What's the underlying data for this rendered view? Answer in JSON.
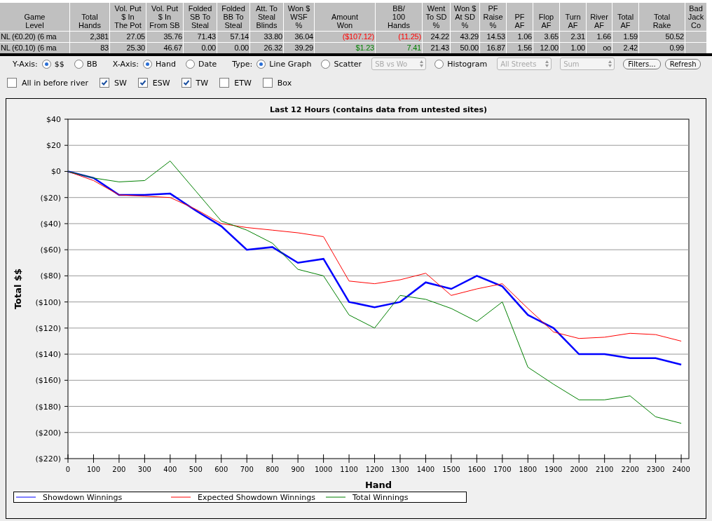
{
  "stats_table": {
    "columns": [
      "Game\nLevel",
      "Total\nHands",
      "Vol. Put\n$ In\nThe Pot",
      "Vol. Put\n$ In\nFrom SB",
      "Folded\nSB To\nSteal",
      "Folded\nBB To\nSteal",
      "Att. To\nSteal\nBlinds",
      "Won $\nWSF\n%",
      "Amount\nWon",
      "BB/\n100\nHands",
      "Went\nTo SD\n%",
      "Won $\nAt SD\n%",
      "PF\nRaise\n%",
      "PF\nAF",
      "Flop\nAF",
      "Turn\nAF",
      "River\nAF",
      "Total\nAF",
      "Total\nRake",
      "Bad\nJack\nCo"
    ],
    "rows": [
      [
        {
          "text": "NL (€0.20) (6 ma"
        },
        {
          "text": "2,381"
        },
        {
          "text": "27.05"
        },
        {
          "text": "35.76"
        },
        {
          "text": "71.43"
        },
        {
          "text": "57.14"
        },
        {
          "text": "33.80"
        },
        {
          "text": "36.04"
        },
        {
          "text": "($107.12)",
          "color": "#ff0000"
        },
        {
          "text": "(11.25)",
          "color": "#ff0000"
        },
        {
          "text": "24.22"
        },
        {
          "text": "43.29"
        },
        {
          "text": "14.53"
        },
        {
          "text": "1.06"
        },
        {
          "text": "3.65"
        },
        {
          "text": "2.31"
        },
        {
          "text": "1.66"
        },
        {
          "text": "1.59"
        },
        {
          "text": "50.52"
        }
      ],
      [
        {
          "text": "NL (€0.10) (6 ma"
        },
        {
          "text": "83"
        },
        {
          "text": "25.30"
        },
        {
          "text": "46.67"
        },
        {
          "text": "0.00"
        },
        {
          "text": "0.00"
        },
        {
          "text": "26.32"
        },
        {
          "text": "39.29"
        },
        {
          "text": "$1.23",
          "color": "#008000"
        },
        {
          "text": "7.41",
          "color": "#008000"
        },
        {
          "text": "21.43"
        },
        {
          "text": "50.00"
        },
        {
          "text": "16.87"
        },
        {
          "text": "1.56"
        },
        {
          "text": "12.00"
        },
        {
          "text": "1.00"
        },
        {
          "text": "oo"
        },
        {
          "text": "2.42"
        },
        {
          "text": "0.99"
        }
      ]
    ]
  },
  "options_rows": [
    [
      {
        "kind": "label",
        "text": "Y-Axis:"
      },
      {
        "kind": "radio",
        "label": "$$",
        "selected": true
      },
      {
        "kind": "radio",
        "label": "BB",
        "selected": false
      },
      {
        "kind": "label",
        "text": "X-Axis:"
      },
      {
        "kind": "radio",
        "label": "Hand",
        "selected": true
      },
      {
        "kind": "radio",
        "label": "Date",
        "selected": false
      },
      {
        "kind": "label",
        "text": "Type:"
      },
      {
        "kind": "radio",
        "label": "Line Graph",
        "selected": true
      },
      {
        "kind": "radio",
        "label": "Scatter",
        "selected": false
      },
      {
        "kind": "dropdown",
        "value": "SB vs Wo",
        "disabled": true
      },
      {
        "kind": "radio",
        "label": "Histogram",
        "selected": false
      },
      {
        "kind": "dropdown",
        "value": "All Streets",
        "disabled": true
      },
      {
        "kind": "dropdown",
        "value": "Sum",
        "disabled": true
      },
      {
        "kind": "button",
        "label": "Filters..."
      },
      {
        "kind": "button",
        "label": "Refresh"
      }
    ],
    [
      {
        "kind": "checkbox",
        "label": "All in before river",
        "checked": false
      },
      {
        "kind": "checkbox",
        "label": "SW",
        "checked": true
      },
      {
        "kind": "checkbox",
        "label": "ESW",
        "checked": true
      },
      {
        "kind": "checkbox",
        "label": "TW",
        "checked": true
      },
      {
        "kind": "checkbox",
        "label": "ETW",
        "checked": false
      },
      {
        "kind": "checkbox",
        "label": "Box",
        "checked": false
      }
    ]
  ],
  "graph": {
    "chart_data": {
      "type": "line",
      "grid": true,
      "title": "Last 12 Hours (contains data from untested sites)",
      "xlabel": "Hand",
      "ylabel": "Total $$",
      "x": [
        0,
        100,
        200,
        300,
        400,
        500,
        600,
        700,
        800,
        900,
        1000,
        1100,
        1200,
        1300,
        1400,
        1500,
        1600,
        1700,
        1800,
        1900,
        2000,
        2100,
        2200,
        2300,
        2400
      ],
      "series": [
        {
          "name": "Showdown Winnings",
          "color": "#0000ff",
          "values": [
            0,
            -5,
            -18,
            -18,
            -17,
            -30,
            -42,
            -60,
            -58,
            -70,
            -67,
            -100,
            -104,
            -100,
            -85,
            -90,
            -80,
            -88,
            -110,
            -120,
            -140,
            -140,
            -143,
            -143,
            -148
          ]
        },
        {
          "name": "Expected Showdown Winnings",
          "color": "#ff0000",
          "values": [
            0,
            -7,
            -18,
            -19,
            -20,
            -29,
            -40,
            -43,
            -45,
            -47,
            -50,
            -84,
            -86,
            -83,
            -78,
            -95,
            -90,
            -86,
            -105,
            -123,
            -128,
            -127,
            -124,
            -125,
            -130
          ]
        },
        {
          "name": "Total Winnings",
          "color": "#008000",
          "values": [
            0,
            -5,
            -8,
            -7,
            8,
            -15,
            -38,
            -45,
            -55,
            -75,
            -80,
            -110,
            -120,
            -95,
            -98,
            -105,
            -115,
            -100,
            -150,
            -163,
            -175,
            -175,
            -172,
            -188,
            -193
          ]
        }
      ],
      "xlim": [
        0,
        2430
      ],
      "ylim": [
        -220,
        40
      ],
      "xticks": [
        0,
        100,
        200,
        300,
        400,
        500,
        600,
        700,
        800,
        900,
        1000,
        1100,
        1200,
        1300,
        1400,
        1500,
        1600,
        1700,
        1800,
        1900,
        2000,
        2100,
        2200,
        2300,
        2400
      ],
      "yticks": [
        {
          "value": 40,
          "label": "$40"
        },
        {
          "value": 20,
          "label": "$20"
        },
        {
          "value": 0,
          "label": "$0"
        },
        {
          "value": -20,
          "label": "($20)"
        },
        {
          "value": -40,
          "label": "($40)"
        },
        {
          "value": -60,
          "label": "($60)"
        },
        {
          "value": -80,
          "label": "($80)"
        },
        {
          "value": -100,
          "label": "($100)"
        },
        {
          "value": -120,
          "label": "($120)"
        },
        {
          "value": -140,
          "label": "($140)"
        },
        {
          "value": -160,
          "label": "($160)"
        },
        {
          "value": -180,
          "label": "($180)"
        },
        {
          "value": -200,
          "label": "($200)"
        },
        {
          "value": -220,
          "label": "($220)"
        }
      ]
    }
  }
}
